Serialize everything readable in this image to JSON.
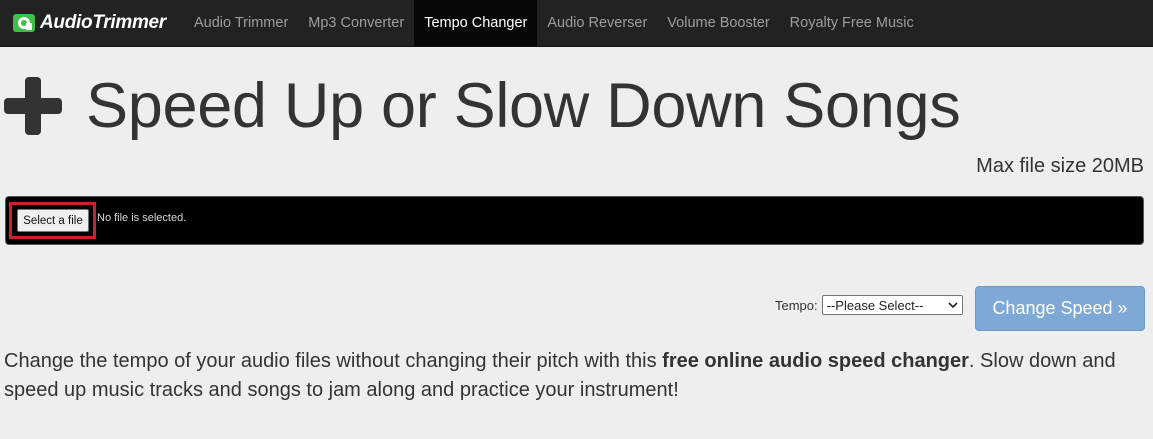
{
  "brand": {
    "name": "AudioTrimmer",
    "logo_icon": "audio-wave-icon",
    "accent": "#3fbf4a"
  },
  "nav": {
    "items": [
      {
        "label": "Audio Trimmer",
        "active": false
      },
      {
        "label": "Mp3 Converter",
        "active": false
      },
      {
        "label": "Tempo Changer",
        "active": true
      },
      {
        "label": "Audio Reverser",
        "active": false
      },
      {
        "label": "Volume Booster",
        "active": false
      },
      {
        "label": "Royalty Free Music",
        "active": false
      }
    ]
  },
  "page": {
    "title": "Speed Up or Slow Down Songs",
    "title_icon": "plus-icon",
    "max_size": "Max file size 20MB"
  },
  "upload": {
    "button_label": "Select a file",
    "status": "No file is selected.",
    "highlight_color": "#d0202a"
  },
  "tempo": {
    "label": "Tempo:",
    "selected": "--Please Select--"
  },
  "submit": {
    "label": "Change Speed »",
    "color": "#7ea8d6"
  },
  "description": {
    "part1": "Change the tempo of your audio files without changing their pitch with this ",
    "bold": "free online audio speed changer",
    "part2": ". Slow down and speed up music tracks and songs to jam along and practice your instrument!"
  }
}
